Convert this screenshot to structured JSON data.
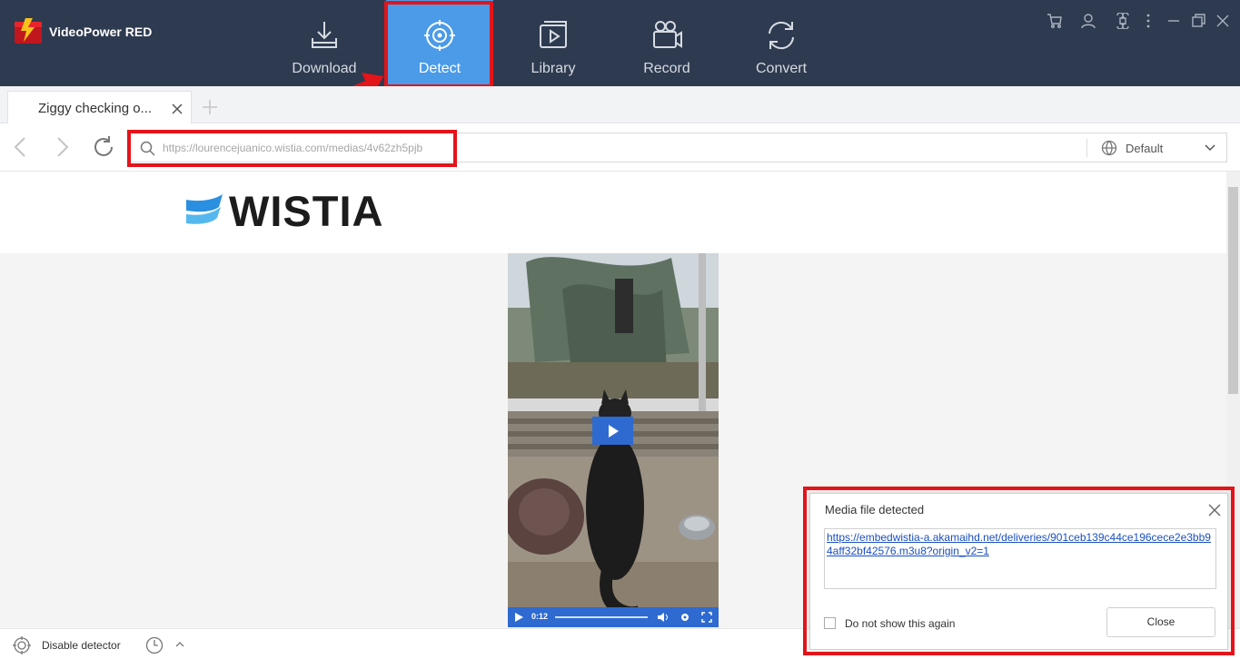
{
  "app": {
    "title": "VideoPower RED"
  },
  "nav": {
    "items": [
      {
        "label": "Download",
        "icon": "download-icon"
      },
      {
        "label": "Detect",
        "icon": "detect-icon",
        "active": true
      },
      {
        "label": "Library",
        "icon": "library-icon"
      },
      {
        "label": "Record",
        "icon": "record-icon"
      },
      {
        "label": "Convert",
        "icon": "convert-icon"
      }
    ]
  },
  "browser": {
    "tab_title": "Ziggy checking o...",
    "url": "https://lourencejuanico.wistia.com/medias/4v62zh5pjb",
    "user_agent": "Default"
  },
  "page": {
    "brand": "WISTIA",
    "video_time": "0:12"
  },
  "bottom": {
    "disable_detector": "Disable detector"
  },
  "popup": {
    "title": "Media file detected",
    "link": "https://embedwistia-a.akamaihd.net/deliveries/901ceb139c44ce196cece2e3bb94aff32bf42576.m3u8?origin_v2=1",
    "dont_show": "Do not show this again",
    "close_label": "Close"
  },
  "colors": {
    "topbar": "#2e3a4f",
    "active_nav": "#4b9be8",
    "highlight": "#e3141a",
    "player_accent": "#2e6ad0"
  }
}
